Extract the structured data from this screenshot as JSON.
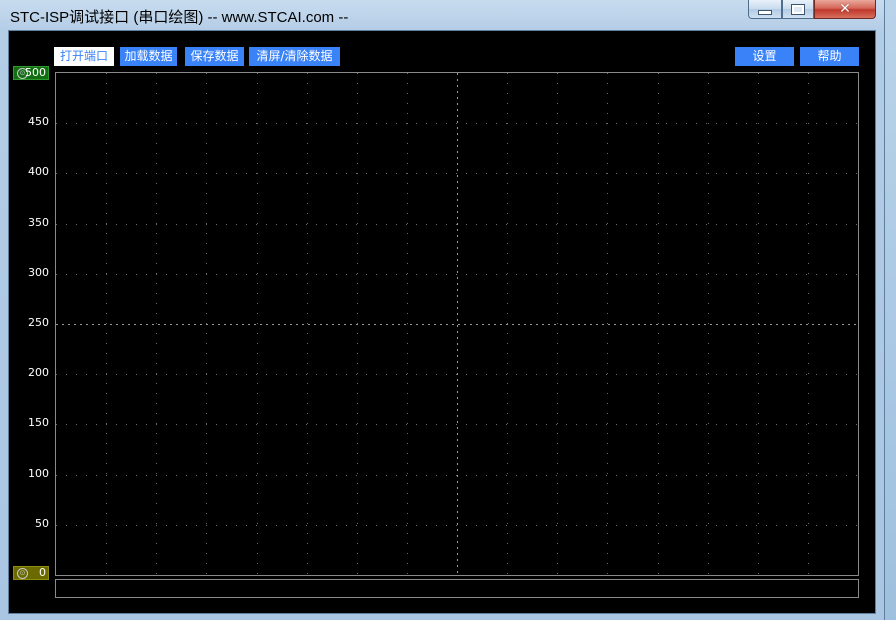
{
  "window": {
    "title": "STC-ISP调试接口 (串口绘图) -- www.STCAI.com --",
    "controls": {
      "minimize": "minimize-icon",
      "maximize": "maximize-icon",
      "close": "close-icon"
    }
  },
  "toolbar": {
    "left_buttons": [
      {
        "label": "打开端口",
        "active": true
      },
      {
        "label": "加载数据",
        "active": false
      },
      {
        "label": "保存数据",
        "active": false
      },
      {
        "label": "清屏/清除数据",
        "active": false
      }
    ],
    "right_buttons": [
      {
        "label": "设置"
      },
      {
        "label": "帮助"
      }
    ]
  },
  "plot": {
    "y_axis": {
      "min": 0,
      "max": 500,
      "step": 50,
      "tick_labels": [
        "500",
        "450",
        "400",
        "350",
        "300",
        "250",
        "200",
        "150",
        "100",
        "50",
        "0"
      ]
    },
    "upper_marker": {
      "value": "500",
      "icon": "marker-circle-icon",
      "color": "#136e13"
    },
    "lower_marker": {
      "value": "0",
      "icon": "marker-circle-icon",
      "color": "#6b6a00"
    },
    "background": "#000000",
    "grid_color": "#6b6b6b",
    "accent_button_color": "#3a82f7"
  }
}
